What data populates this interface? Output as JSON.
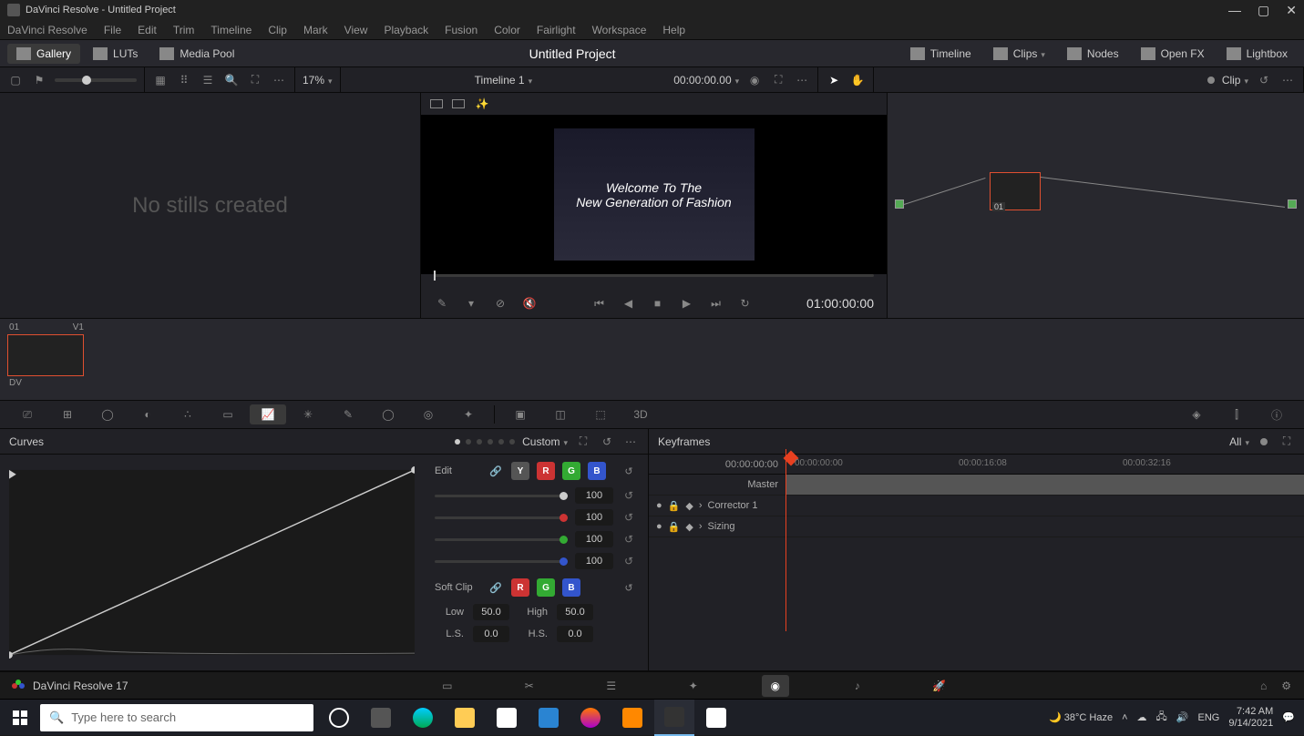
{
  "titlebar": {
    "text": "DaVinci Resolve - Untitled Project"
  },
  "menu": [
    "DaVinci Resolve",
    "File",
    "Edit",
    "Trim",
    "Timeline",
    "Clip",
    "Mark",
    "View",
    "Playback",
    "Fusion",
    "Color",
    "Fairlight",
    "Workspace",
    "Help"
  ],
  "toprow": {
    "left": [
      {
        "label": "Gallery",
        "active": true
      },
      {
        "label": "LUTs",
        "active": false
      },
      {
        "label": "Media Pool",
        "active": false
      }
    ],
    "title": "Untitled Project",
    "right": [
      {
        "label": "Timeline"
      },
      {
        "label": "Clips",
        "chev": true
      },
      {
        "label": "Nodes"
      },
      {
        "label": "Open FX"
      },
      {
        "label": "Lightbox"
      }
    ]
  },
  "subbar": {
    "zoom": "17%",
    "timeline_label": "Timeline 1",
    "timecode": "00:00:00.00",
    "clip_label": "Clip"
  },
  "gallery": {
    "empty": "No stills created"
  },
  "viewer": {
    "overlay_line1": "Welcome To The",
    "overlay_line2": "New Generation of Fashion",
    "timecode": "01:00:00:00"
  },
  "node": {
    "label": "01"
  },
  "thumb": {
    "idx": "01",
    "track": "V1",
    "name": "DV"
  },
  "curves": {
    "title": "Curves",
    "mode": "Custom",
    "edit_label": "Edit",
    "channels": [
      {
        "color": "#ccc",
        "val": "100"
      },
      {
        "color": "#c33",
        "val": "100"
      },
      {
        "color": "#3a3",
        "val": "100"
      },
      {
        "color": "#35c",
        "val": "100"
      }
    ],
    "softclip_label": "Soft Clip",
    "low_label": "Low",
    "low_val": "50.0",
    "high_label": "High",
    "high_val": "50.0",
    "ls_label": "L.S.",
    "ls_val": "0.0",
    "hs_label": "H.S.",
    "hs_val": "0.0"
  },
  "keyframes": {
    "title": "Keyframes",
    "all": "All",
    "tc0": "00:00:00:00",
    "tc1": "00:00:00:00",
    "tc2": "00:00:16:08",
    "tc3": "00:00:32:16",
    "master": "Master",
    "rows": [
      "Corrector 1",
      "Sizing"
    ]
  },
  "pagebar": {
    "app": "DaVinci Resolve 17"
  },
  "taskbar": {
    "search_placeholder": "Type here to search",
    "weather": "38°C  Haze",
    "time": "7:42 AM",
    "date": "9/14/2021"
  }
}
